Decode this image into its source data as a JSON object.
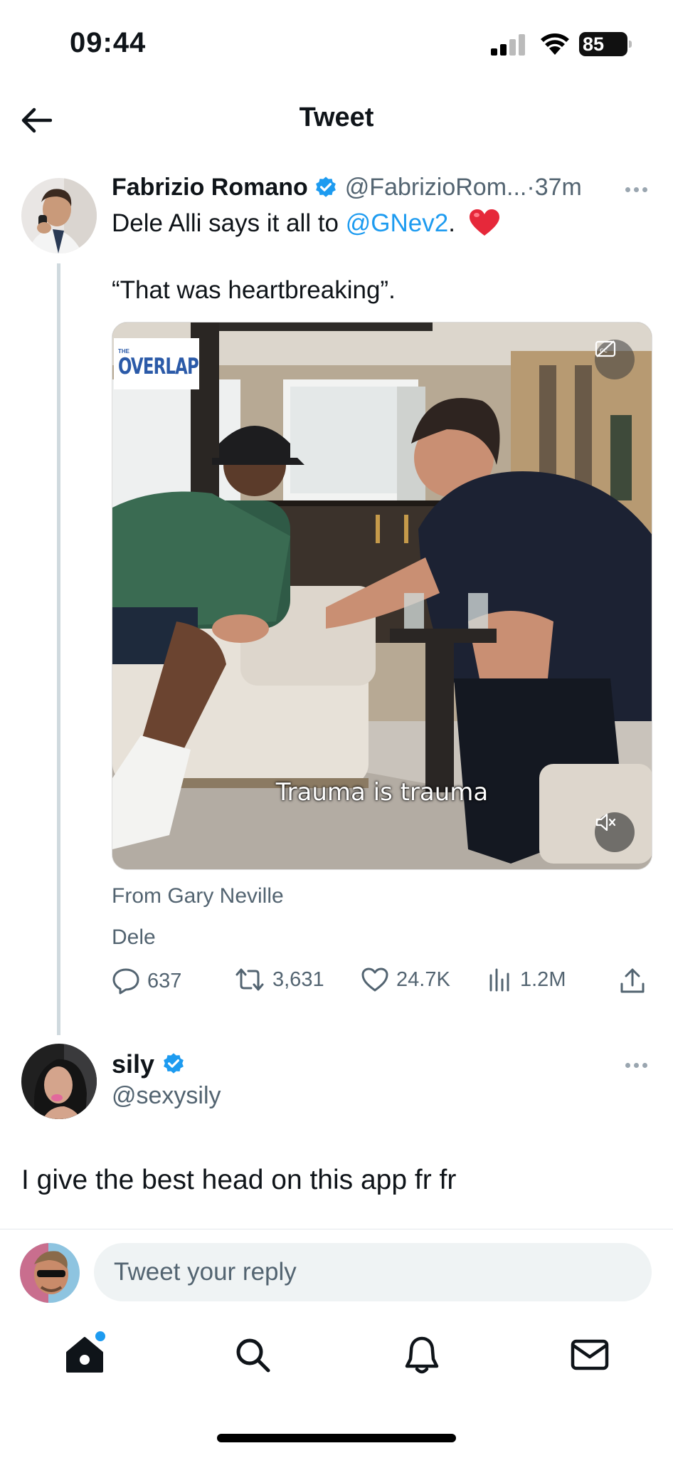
{
  "status_bar": {
    "time": "09:44",
    "battery": "85"
  },
  "header": {
    "title": "Tweet",
    "back_icon": "arrow-left-icon"
  },
  "tweet": {
    "author_name": "Fabrizio Romano",
    "author_handle": "@FabrizioRom...",
    "time_sep": " · ",
    "time": "37m",
    "text_line1_prefix": "Dele Alli says it all to ",
    "mention": "@GNev2",
    "text_line1_suffix": ".",
    "emoji": "red-heart",
    "text_line2": "“That was heartbreaking”.",
    "media": {
      "brand_small": "THE",
      "brand": "OVERLAP",
      "caption": "Trauma is trauma",
      "cc_icon": "closed-captions-off-icon",
      "mute_icon": "speaker-muted-icon"
    },
    "from_line": "From Gary Neville",
    "media_title": "Dele",
    "stats": {
      "replies": "637",
      "retweets": "3,631",
      "likes": "24.7K",
      "views": "1.2M"
    }
  },
  "reply": {
    "author_name": "sily",
    "author_handle": "@sexysily",
    "text": "I give the best head on this app fr fr"
  },
  "composer": {
    "placeholder": "Tweet your reply"
  },
  "bottom_nav": [
    "home-icon",
    "search-icon",
    "notifications-bell-icon",
    "messages-envelope-icon"
  ],
  "colors": {
    "accent": "#1d9bf0",
    "secondary_text": "#536471",
    "heart": "#e0245e"
  }
}
